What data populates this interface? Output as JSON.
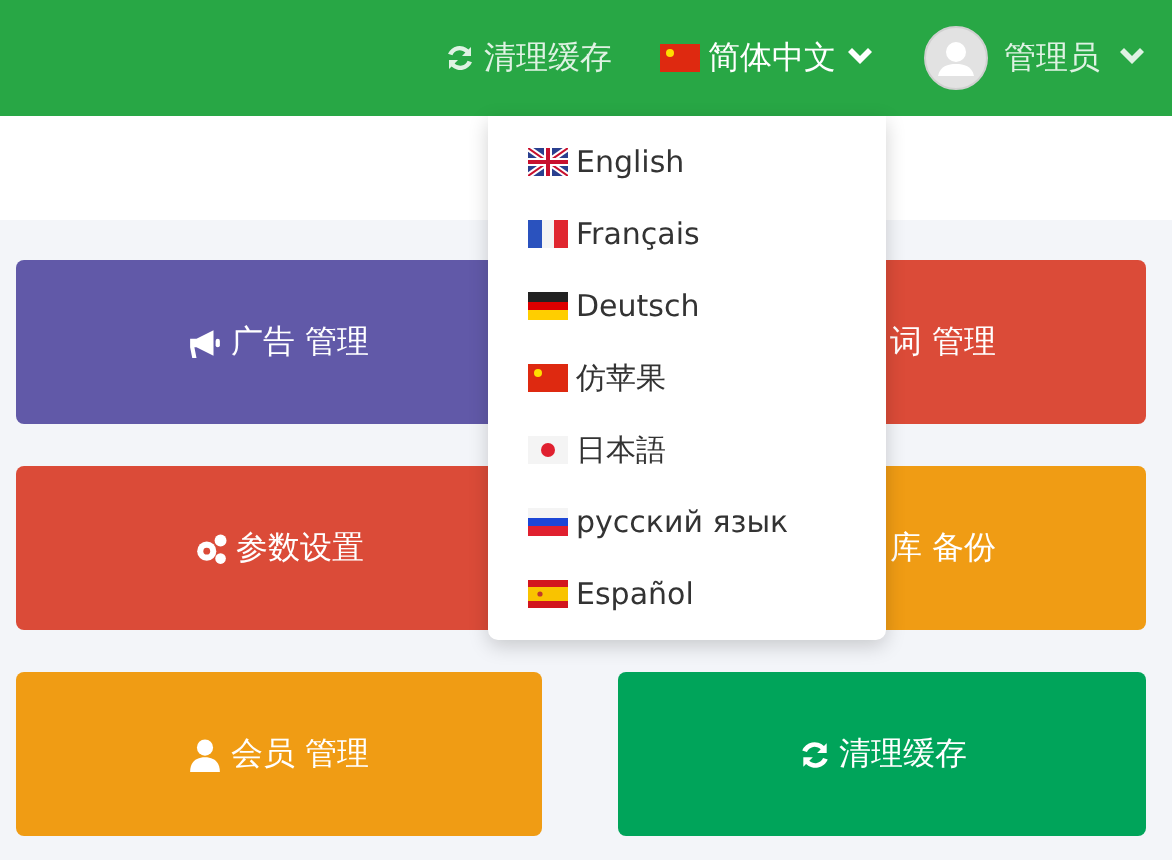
{
  "navbar": {
    "clear_cache": {
      "label": "清理缓存"
    },
    "language": {
      "label": "简体中文",
      "expanded": true
    },
    "user": {
      "label": "管理员"
    }
  },
  "language_menu": [
    {
      "label": "English"
    },
    {
      "label": "Français"
    },
    {
      "label": "Deutsch"
    },
    {
      "label": "仿苹果"
    },
    {
      "label": "日本語"
    },
    {
      "label": "русский язык"
    },
    {
      "label": "Español"
    }
  ],
  "tiles": [
    {
      "label": "广告 管理",
      "color": "#6159a8"
    },
    {
      "label": "词 管理",
      "color": "#db4b38"
    },
    {
      "label": "参数设置",
      "color": "#db4b38"
    },
    {
      "label": "库 备份",
      "color": "#f09c14"
    },
    {
      "label": "会员 管理",
      "color": "#f09c14"
    },
    {
      "label": "清理缓存",
      "color": "#00a45a"
    }
  ]
}
